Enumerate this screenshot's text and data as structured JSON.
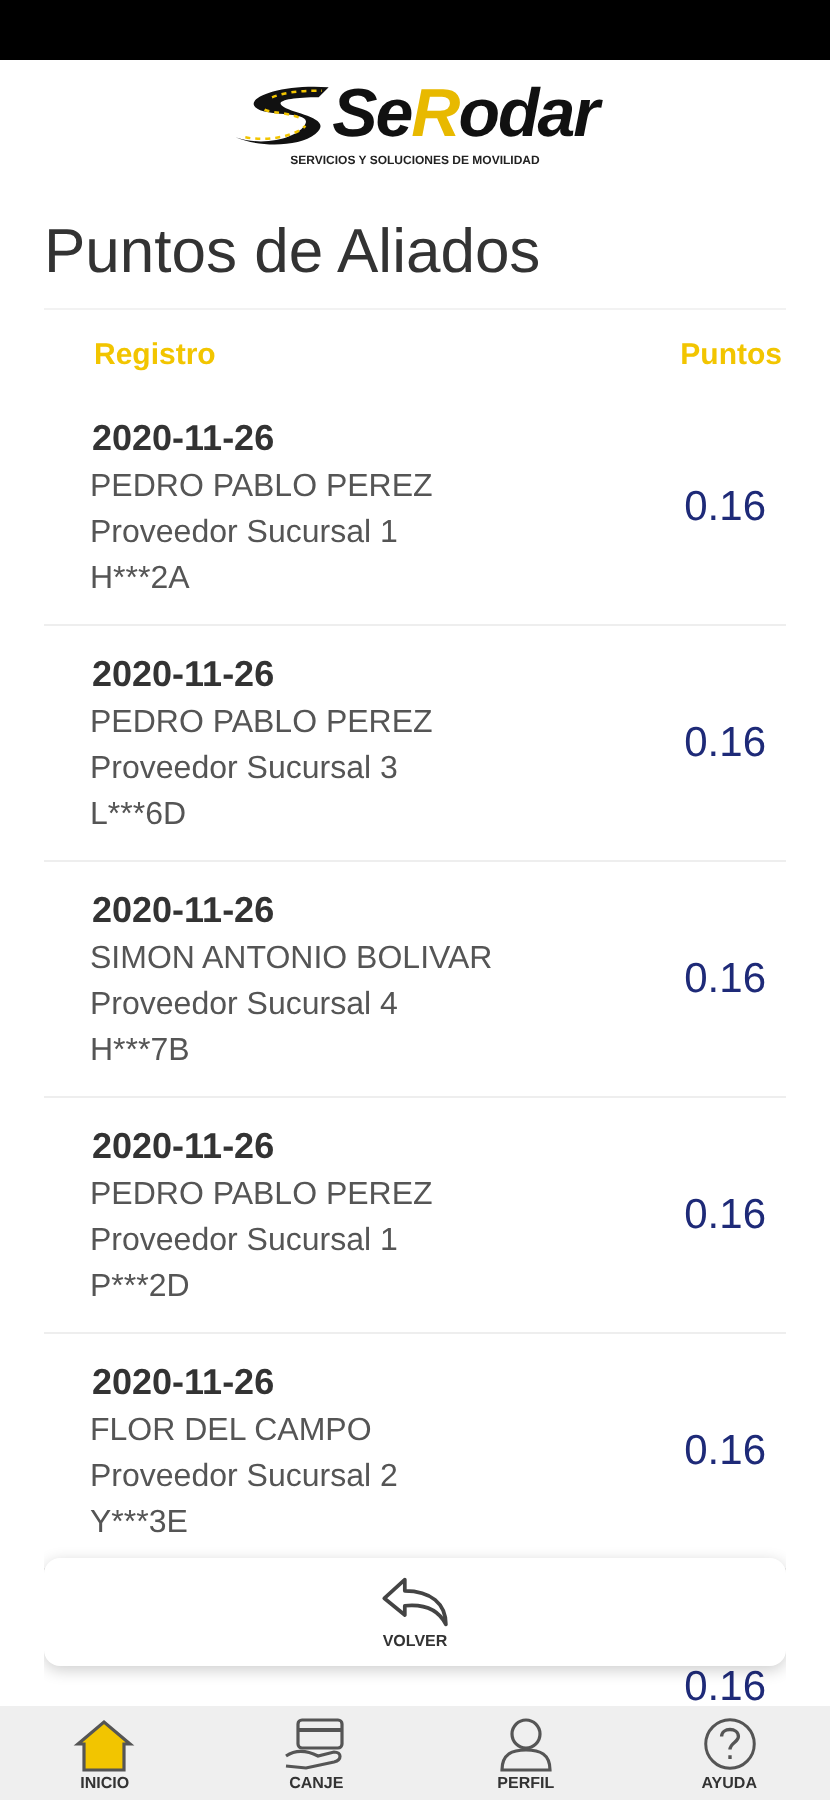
{
  "logo": {
    "part_1": "Se",
    "part_2": "R",
    "part_3": "odar",
    "tagline": "SERVICIOS Y SOLUCIONES DE MOVILIDAD"
  },
  "title": "Puntos de Aliados",
  "table": {
    "columns": [
      "Registro",
      "Puntos"
    ],
    "rows": [
      {
        "date": "2020-11-26",
        "name": "PEDRO PABLO PEREZ",
        "branch": "Proveedor Sucursal 1",
        "code": "H***2A",
        "points": "0.16"
      },
      {
        "date": "2020-11-26",
        "name": "PEDRO PABLO PEREZ",
        "branch": "Proveedor Sucursal 3",
        "code": "L***6D",
        "points": "0.16"
      },
      {
        "date": "2020-11-26",
        "name": "SIMON ANTONIO BOLIVAR",
        "branch": "Proveedor Sucursal 4",
        "code": "H***7B",
        "points": "0.16"
      },
      {
        "date": "2020-11-26",
        "name": "PEDRO PABLO PEREZ",
        "branch": "Proveedor Sucursal 1",
        "code": "P***2D",
        "points": "0.16"
      },
      {
        "date": "2020-11-26",
        "name": "FLOR DEL CAMPO",
        "branch": "Proveedor Sucursal 2",
        "code": "Y***3E",
        "points": "0.16"
      },
      {
        "points": "0.16"
      }
    ]
  },
  "back_button": {
    "label": "VOLVER"
  },
  "nav": [
    {
      "label": "INICIO",
      "kind": "home",
      "selected": true
    },
    {
      "label": "CANJE",
      "kind": "card",
      "selected": false
    },
    {
      "label": "PERFIL",
      "kind": "user",
      "selected": false
    },
    {
      "label": "AYUDA",
      "kind": "help",
      "selected": false
    }
  ]
}
